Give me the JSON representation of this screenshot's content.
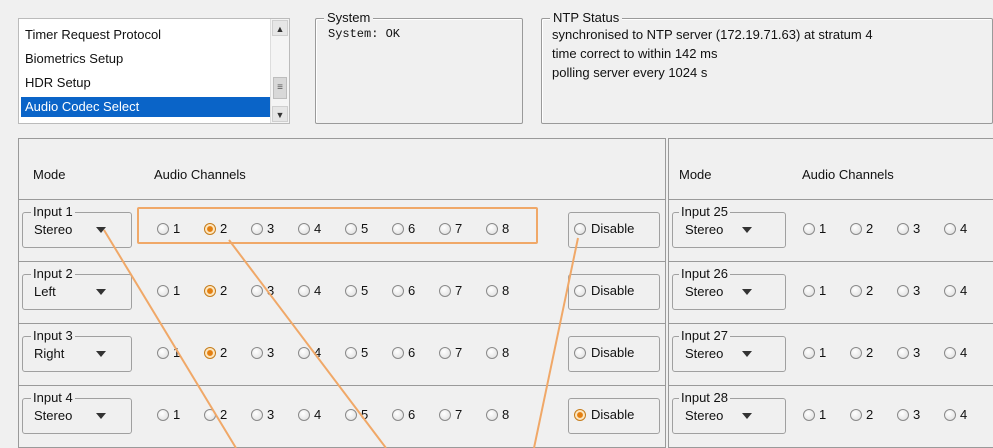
{
  "menu": {
    "items": [
      {
        "label": "Timer Request Protocol",
        "selected": false
      },
      {
        "label": "Biometrics Setup",
        "selected": false
      },
      {
        "label": "HDR Setup",
        "selected": false
      },
      {
        "label": "Audio Codec Select",
        "selected": true
      }
    ]
  },
  "system": {
    "title": "System",
    "status": "System: OK"
  },
  "ntp": {
    "title": "NTP Status",
    "lines": [
      "synchronised to NTP server (172.19.71.63) at stratum 4",
      "time correct to within 142 ms",
      "polling server every 1024 s"
    ]
  },
  "left_table": {
    "mode_header": "Mode",
    "channels_header": "Audio Channels",
    "rows": [
      {
        "input": "Input 1",
        "mode": "Stereo",
        "selected": "2"
      },
      {
        "input": "Input 2",
        "mode": "Left",
        "selected": "2"
      },
      {
        "input": "Input 3",
        "mode": "Right",
        "selected": "2"
      },
      {
        "input": "Input 4",
        "mode": "Stereo",
        "selected": "Disable"
      }
    ],
    "channels": [
      "1",
      "2",
      "3",
      "4",
      "5",
      "6",
      "7",
      "8"
    ],
    "disable_label": "Disable"
  },
  "right_table": {
    "mode_header": "Mode",
    "channels_header": "Audio Channels",
    "rows": [
      {
        "input": "Input 25",
        "mode": "Stereo"
      },
      {
        "input": "Input 26",
        "mode": "Stereo"
      },
      {
        "input": "Input 27",
        "mode": "Stereo"
      },
      {
        "input": "Input 28",
        "mode": "Stereo"
      }
    ],
    "channels": [
      "1",
      "2",
      "3",
      "4"
    ]
  },
  "colors": {
    "accent": "#e47f10",
    "selection": "#0a64c8",
    "annotation": "#f0a868"
  }
}
